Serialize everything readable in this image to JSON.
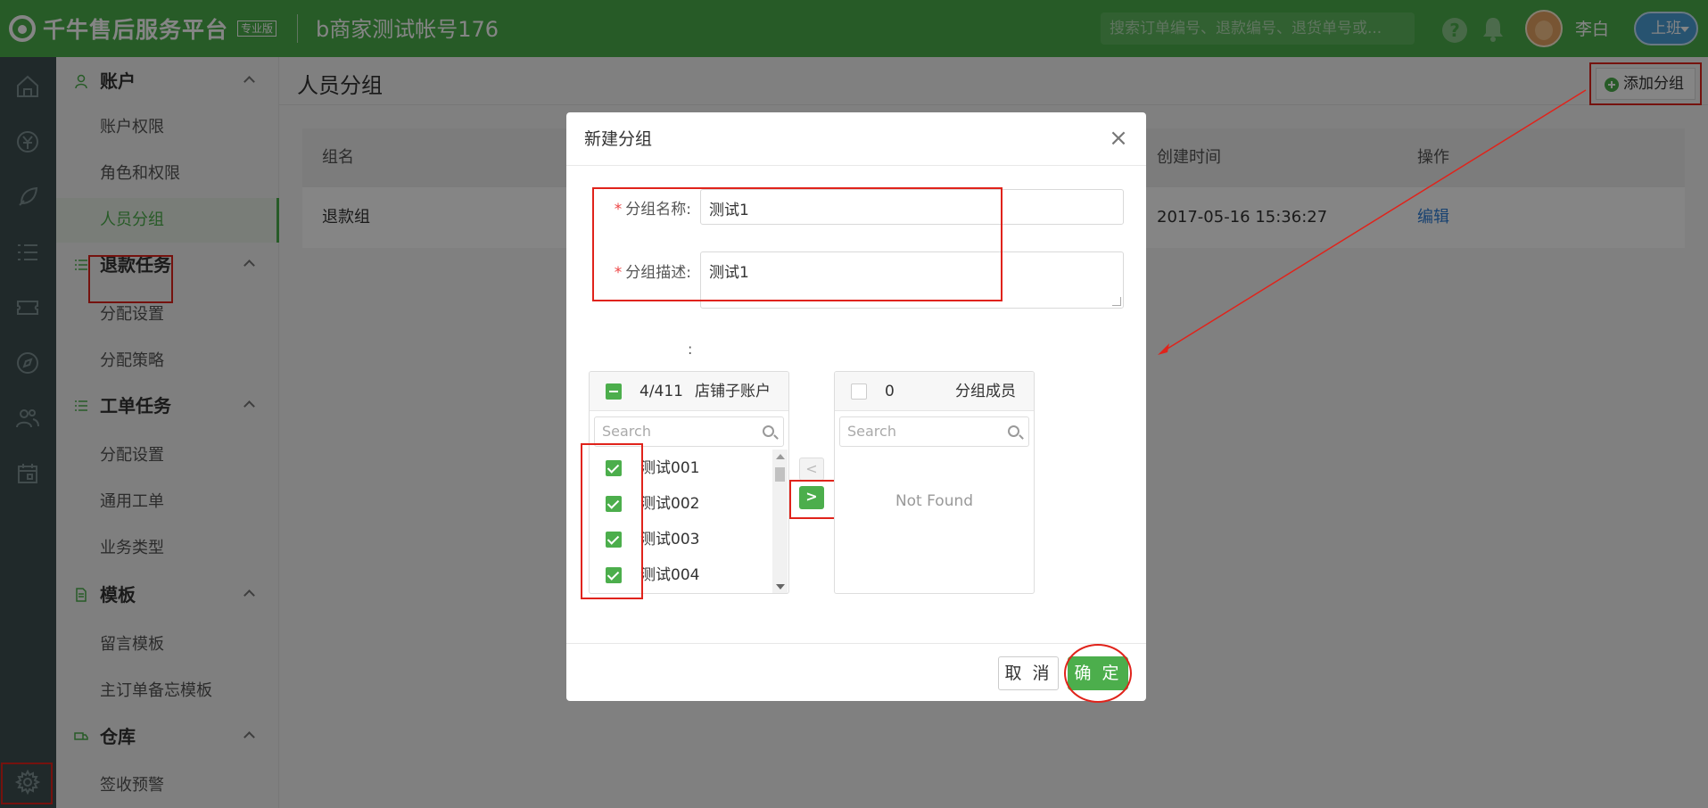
{
  "header": {
    "brand_name": "千牛售后服务平台",
    "brand_tag": "专业版",
    "account": "b商家测试帐号176",
    "search_placeholder": "搜索订单编号、退款编号、退货单号或...",
    "help_icon": "question-mark",
    "user_name": "李白",
    "duty_status": "上班"
  },
  "rail": {
    "icons": [
      "home-icon",
      "yuan-icon",
      "rocket-icon",
      "task-list-icon",
      "ticket-icon",
      "compass-icon",
      "people-icon",
      "calendar-icon",
      "gear-icon"
    ]
  },
  "sidebar": {
    "sections": [
      {
        "title": "账户",
        "icon": "user-icon",
        "items": [
          "账户权限",
          "角色和权限",
          "人员分组"
        ]
      },
      {
        "title": "退款任务",
        "icon": "list-icon",
        "items": [
          "分配设置",
          "分配策略"
        ]
      },
      {
        "title": "工单任务",
        "icon": "list-icon",
        "items": [
          "分配设置",
          "通用工单",
          "业务类型"
        ]
      },
      {
        "title": "模板",
        "icon": "document-icon",
        "items": [
          "留言模板",
          "主订单备忘模板"
        ]
      },
      {
        "title": "仓库",
        "icon": "truck-icon",
        "items": [
          "签收预警"
        ]
      }
    ],
    "active_item": "人员分组"
  },
  "main": {
    "page_title": "人员分组",
    "add_button": "添加分组",
    "table": {
      "headers": [
        "组名",
        "创建时间",
        "操作"
      ],
      "rows": [
        {
          "name": "退款组",
          "created": "2017-05-16 15:36:27",
          "action": "编辑"
        }
      ]
    }
  },
  "modal": {
    "title": "新建分组",
    "close_icon": "×",
    "name_label": "分组名称:",
    "name_value": "测试1",
    "desc_label": "分组描述:",
    "desc_value": "测试1",
    "members_label": ":",
    "left_panel": {
      "count": "4/411",
      "title": "店铺子账户",
      "search_placeholder": "Search",
      "items": [
        "测试001",
        "测试002",
        "测试003",
        "测试004"
      ]
    },
    "right_panel": {
      "count": "0",
      "title": "分组成员",
      "search_placeholder": "Search",
      "empty_text": "Not Found"
    },
    "move_left": "<",
    "move_right": ">",
    "cancel": "取 消",
    "ok": "确 定"
  },
  "colors": {
    "brand_green": "#4cae4c",
    "annotation_red": "#e0231b",
    "link_blue": "#2f7fd8",
    "rail_bg": "#3e4f52"
  }
}
